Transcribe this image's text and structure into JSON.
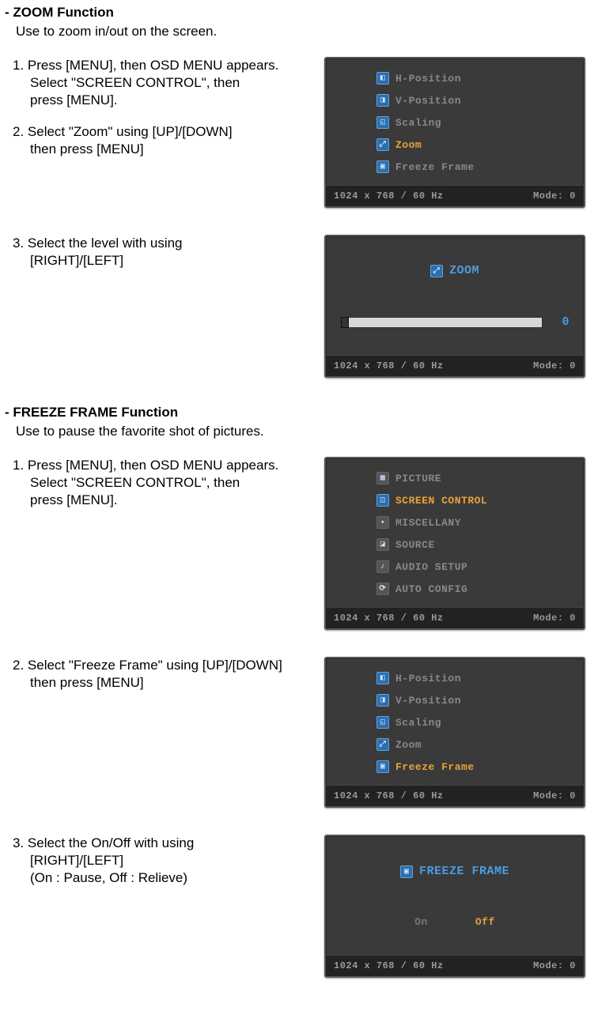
{
  "zoom": {
    "title": "- ZOOM Function",
    "desc": "Use to zoom in/out on the screen.",
    "step1_l1": "1. Press [MENU], then OSD MENU appears.",
    "step1_l2": "Select \"SCREEN CONTROL\", then",
    "step1_l3": "press [MENU].",
    "step2_l1": "2. Select \"Zoom\" using [UP]/[DOWN]",
    "step2_l2": "then press [MENU]",
    "step3_l1": "3. Select the level with using",
    "step3_l2": "[RIGHT]/[LEFT]"
  },
  "freeze": {
    "title": "- FREEZE FRAME Function",
    "desc": "Use to pause the favorite shot of pictures.",
    "step1_l1": "1. Press [MENU], then OSD MENU appears.",
    "step1_l2": "Select \"SCREEN CONTROL\", then",
    "step1_l3": "press [MENU].",
    "step2_l1": "2. Select \"Freeze Frame\" using [UP]/[DOWN]",
    "step2_l2": "then press [MENU]",
    "step3_l1": "3. Select the On/Off with using",
    "step3_l2": "[RIGHT]/[LEFT]",
    "step3_l3": "(On : Pause, Off : Relieve)"
  },
  "osd_menu_sc": {
    "i0": "H-Position",
    "i1": "V-Position",
    "i2": "Scaling",
    "i3": "Zoom",
    "i4": "Freeze Frame"
  },
  "osd_zoom": {
    "title": "ZOOM",
    "value": "0"
  },
  "osd_main": {
    "i0": "PICTURE",
    "i1": "SCREEN  CONTROL",
    "i2": "MISCELLANY",
    "i3": "SOURCE",
    "i4": "AUDIO  SETUP",
    "i5": "AUTO  CONFIG"
  },
  "osd_ff": {
    "title": "FREEZE  FRAME",
    "on": "On",
    "off": "Off"
  },
  "status": {
    "left": "1024  x   768  /   60  Hz",
    "right": "Mode:   0"
  }
}
